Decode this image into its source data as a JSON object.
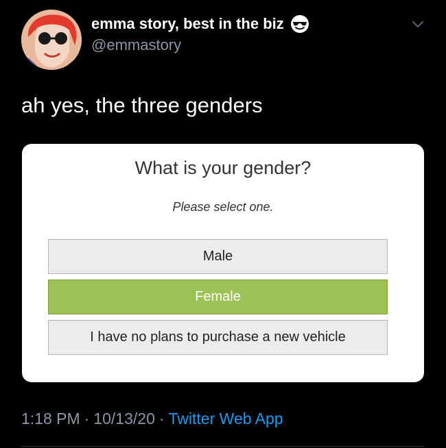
{
  "tweet": {
    "display_name": "emma story, best in the biz",
    "handle": "@emmastory",
    "text": "ah yes, the three genders",
    "emoji_icon": "smiling-face-with-sunglasses-icon",
    "time": "1:18 PM",
    "date": "10/13/20",
    "separator": "·",
    "source_app": "Twitter Web App"
  },
  "embedded_form": {
    "question": "What is your gender?",
    "instruction": "Please select one.",
    "options": [
      {
        "label": "Male",
        "selected": false
      },
      {
        "label": "Female",
        "selected": true
      },
      {
        "label": "I have no plans to purchase a new vehicle",
        "selected": false
      }
    ]
  },
  "colors": {
    "background": "#000000",
    "secondary_text": "#8b98a5",
    "link": "#1d9bf0",
    "selected_option": "#9cc154",
    "option_default": "#ececec"
  }
}
